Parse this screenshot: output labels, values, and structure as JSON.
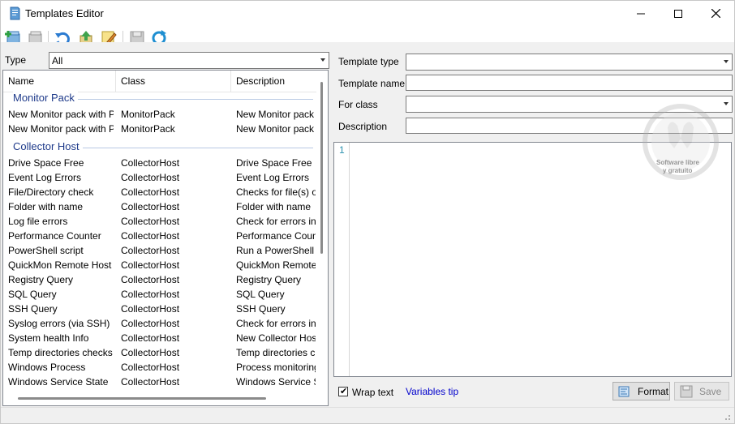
{
  "window": {
    "title": "Templates Editor"
  },
  "toolbar": {
    "buttons": [
      "new-template-icon",
      "delete-template-icon",
      "undo-icon",
      "import-icon",
      "edit-icon",
      "save-icon",
      "refresh-icon"
    ]
  },
  "filter": {
    "label": "Type",
    "value": "All"
  },
  "list": {
    "columns": [
      "Name",
      "Class",
      "Description"
    ],
    "groups": [
      {
        "title": "Monitor Pack",
        "rows": [
          [
            "New Monitor pack with P...",
            "MonitorPack",
            "New Monitor pack w"
          ],
          [
            "New Monitor pack with P...",
            "MonitorPack",
            "New Monitor pack w"
          ]
        ]
      },
      {
        "title": "Collector Host",
        "rows": [
          [
            "Drive Space Free",
            "CollectorHost",
            "Drive Space Free"
          ],
          [
            "Event Log Errors",
            "CollectorHost",
            "Event Log Errors"
          ],
          [
            "File/Directory check",
            "CollectorHost",
            "Checks for file(s) or d"
          ],
          [
            "Folder with name",
            "CollectorHost",
            "Folder with name"
          ],
          [
            "Log file errors",
            "CollectorHost",
            "Check for errors in a"
          ],
          [
            "Performance Counter",
            "CollectorHost",
            "Performance Counte"
          ],
          [
            "PowerShell script",
            "CollectorHost",
            "Run a PowerShell sc"
          ],
          [
            "QuickMon Remote Host ...",
            "CollectorHost",
            "QuickMon Remote H"
          ],
          [
            "Registry Query",
            "CollectorHost",
            "Registry Query"
          ],
          [
            "SQL Query",
            "CollectorHost",
            "SQL Query"
          ],
          [
            "SSH Query",
            "CollectorHost",
            "SSH Query"
          ],
          [
            "Syslog errors (via SSH)",
            "CollectorHost",
            "Check for errors in Sy"
          ],
          [
            "System health Info",
            "CollectorHost",
            "New Collector Host w"
          ],
          [
            "Temp directories checks",
            "CollectorHost",
            "Temp directories che"
          ],
          [
            "Windows Process",
            "CollectorHost",
            "Process monitoring"
          ],
          [
            "Windows Service State",
            "CollectorHost",
            "Windows Service Sta"
          ]
        ]
      }
    ]
  },
  "form": {
    "template_type_label": "Template type",
    "template_type_value": "",
    "template_name_label": "Template name",
    "template_name_value": "",
    "for_class_label": "For class",
    "for_class_value": "",
    "description_label": "Description",
    "description_value": ""
  },
  "editor": {
    "line_number": "1",
    "content": ""
  },
  "bottom": {
    "wrap_text_label": "Wrap text",
    "wrap_text_checked": true,
    "variables_tip_label": "Variables tip",
    "format_label": "Format",
    "save_label": "Save"
  },
  "watermark": {
    "line1": "Software libre",
    "line2": "y gratuito"
  },
  "colors": {
    "group_title": "#1e3a8a",
    "link": "#0000cc",
    "line_number": "#2b91af"
  }
}
